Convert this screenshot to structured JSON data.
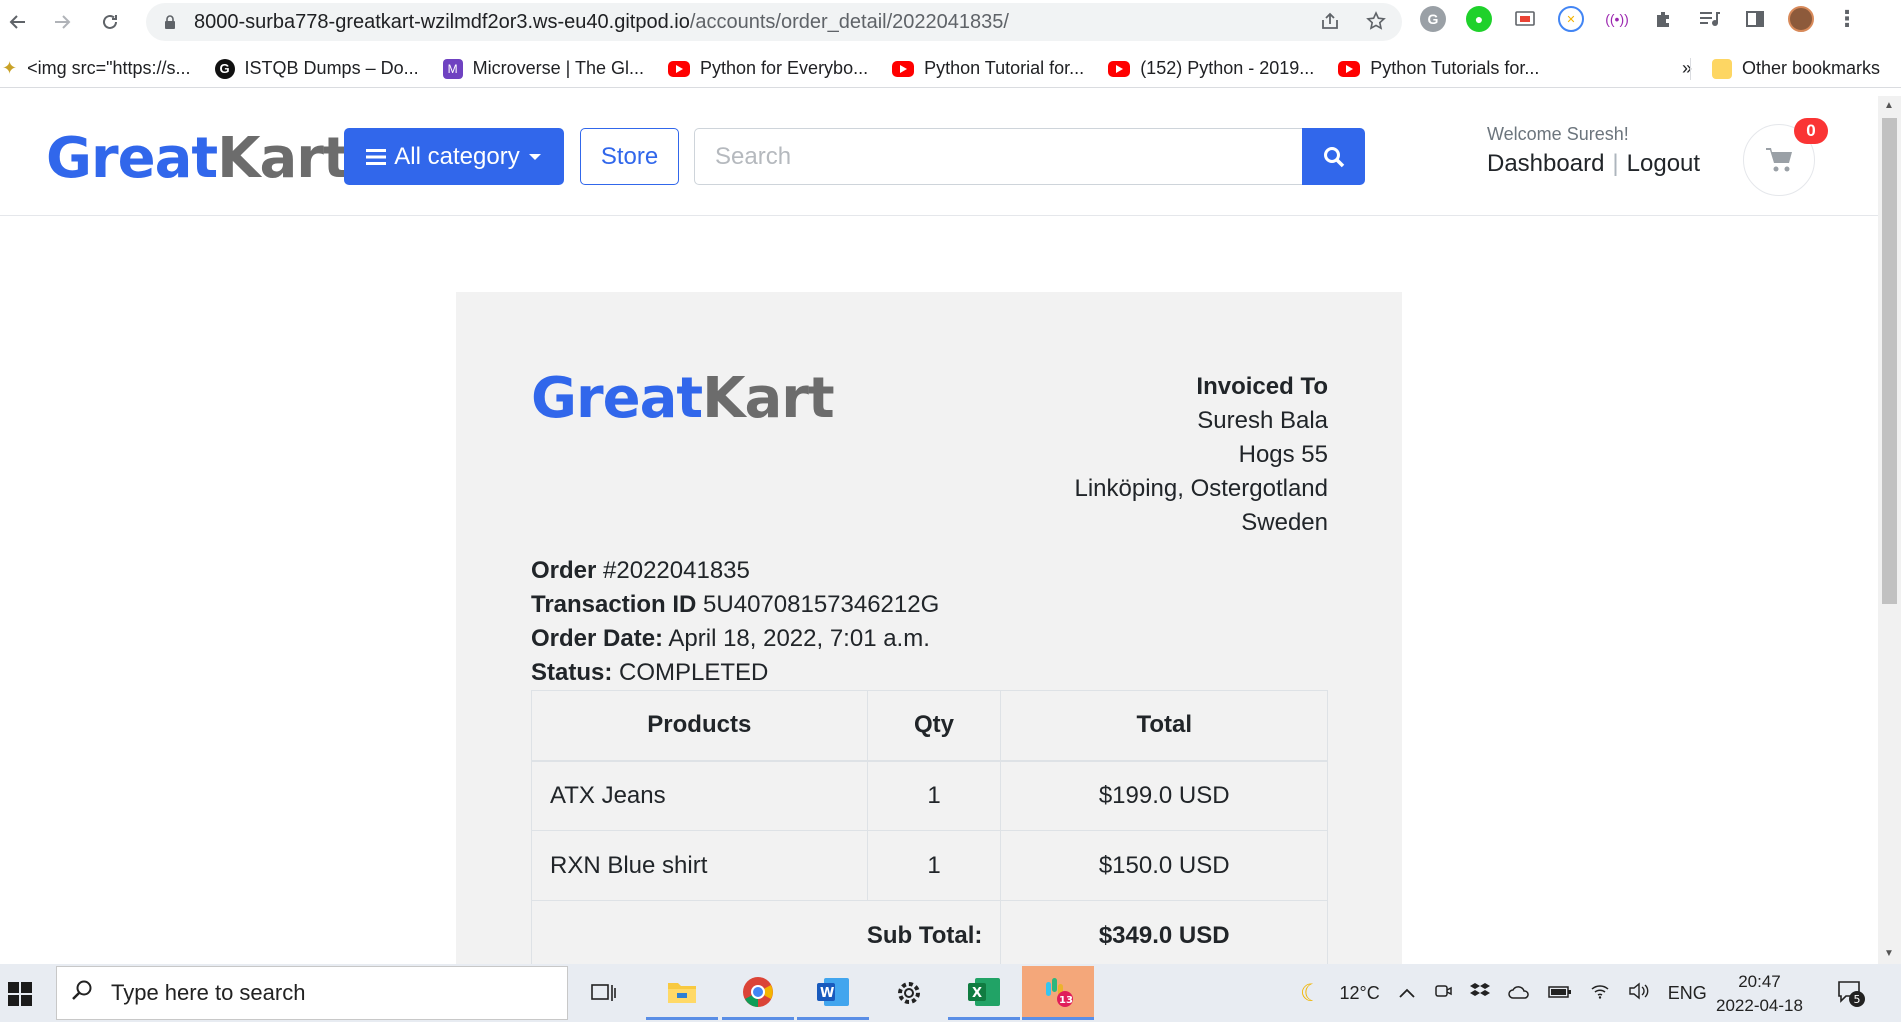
{
  "browser": {
    "url_host": "8000-surba778-greatkart-wzilmdf2or3.ws-eu40.gitpod.io",
    "url_path": "/accounts/order_detail/2022041835/",
    "bookmarks": [
      {
        "label": "<img src=\"https://s...",
        "icon": "generic-favicon-icon"
      },
      {
        "label": "ISTQB Dumps – Do...",
        "icon": "g-circle-icon"
      },
      {
        "label": "Microverse | The Gl...",
        "icon": "microverse-icon"
      },
      {
        "label": "Python for Everybo...",
        "icon": "youtube-icon"
      },
      {
        "label": "Python Tutorial for...",
        "icon": "youtube-icon"
      },
      {
        "label": "(152) Python - 2019...",
        "icon": "youtube-icon"
      },
      {
        "label": "Python Tutorials for...",
        "icon": "youtube-icon"
      }
    ],
    "overflow": "»",
    "other_bookmarks": "Other bookmarks"
  },
  "site": {
    "logo_part1": "Great",
    "logo_part2": "Kart",
    "category_label": "All category",
    "store_label": "Store",
    "search_placeholder": "Search",
    "welcome": "Welcome Suresh!",
    "dashboard_link": "Dashboard",
    "logout_link": "Logout",
    "cart_count": "0"
  },
  "invoice": {
    "logo_part1": "Great",
    "logo_part2": "Kart",
    "invoiced_to_label": "Invoiced To",
    "customer_name": "Suresh Bala",
    "address_line1": "Hogs 55",
    "address_line2": "Linköping, Ostergotland",
    "country": "Sweden",
    "order_label": "Order",
    "order_number": "#2022041835",
    "transaction_label": "Transaction ID",
    "transaction_id": "5U407081573462​12G",
    "order_date_label": "Order Date:",
    "order_date": "April 18, 2022, 7:01 a.m.",
    "status_label": "Status:",
    "status": "COMPLETED",
    "columns": [
      "Products",
      "Qty",
      "Total"
    ],
    "items": [
      {
        "product": "ATX Jeans",
        "qty": "1",
        "total": "$199.0 USD"
      },
      {
        "product": "RXN Blue shirt",
        "qty": "1",
        "total": "$150.0 USD"
      }
    ],
    "subtotal_label": "Sub Total:",
    "subtotal": "$349.0 USD"
  },
  "taskbar": {
    "search_placeholder": "Type here to search",
    "weather": "12°C",
    "language": "ENG",
    "time": "20:47",
    "date": "2022-04-18",
    "notification_count": "5",
    "slack_badge": "13"
  },
  "colors": {
    "brand_blue": "#3167eb",
    "logo_gray": "#6c6c6c",
    "badge_red": "#fa3434"
  }
}
